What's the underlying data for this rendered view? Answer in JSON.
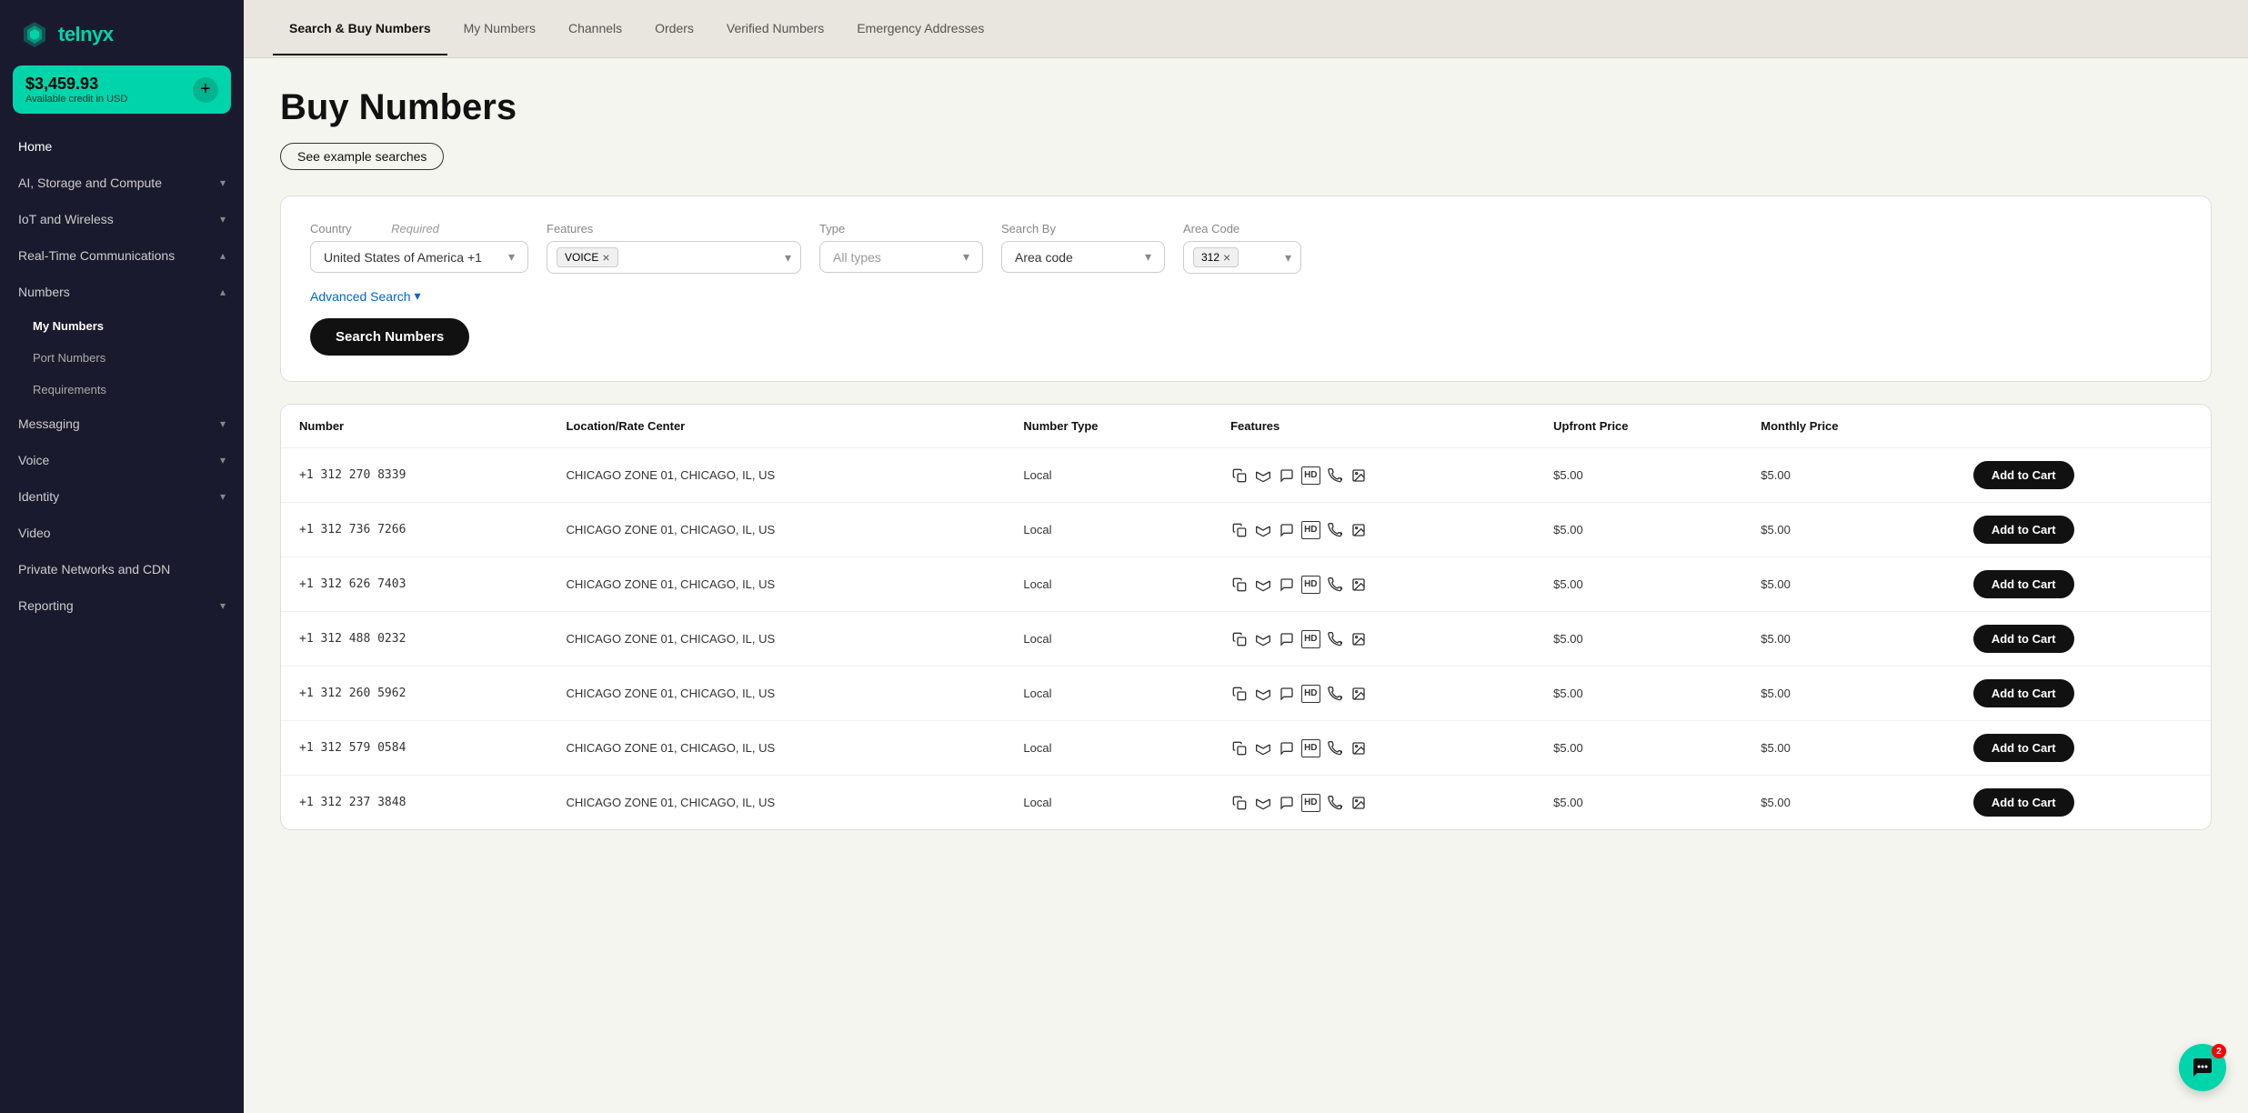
{
  "sidebar": {
    "logo": "telnyx",
    "credit": {
      "amount": "$3,459.93",
      "label": "Available credit in USD"
    },
    "nav_items": [
      {
        "id": "home",
        "label": "Home",
        "hasChildren": false
      },
      {
        "id": "ai-storage",
        "label": "AI, Storage and Compute",
        "hasChildren": true
      },
      {
        "id": "iot-wireless",
        "label": "IoT and Wireless",
        "hasChildren": true
      },
      {
        "id": "real-time",
        "label": "Real-Time Communications",
        "hasChildren": true,
        "expanded": true
      },
      {
        "id": "numbers",
        "label": "Numbers",
        "hasChildren": true,
        "expanded": true
      },
      {
        "id": "messaging",
        "label": "Messaging",
        "hasChildren": true
      },
      {
        "id": "voice",
        "label": "Voice",
        "hasChildren": true
      },
      {
        "id": "identity",
        "label": "Identity",
        "hasChildren": true
      },
      {
        "id": "video",
        "label": "Video",
        "hasChildren": false
      },
      {
        "id": "private-networks",
        "label": "Private Networks and CDN",
        "hasChildren": false
      },
      {
        "id": "reporting",
        "label": "Reporting",
        "hasChildren": true
      }
    ],
    "sub_items": [
      {
        "label": "My Numbers",
        "active": true
      },
      {
        "label": "Port Numbers",
        "active": false
      },
      {
        "label": "Requirements",
        "active": false
      }
    ]
  },
  "top_nav": {
    "tabs": [
      {
        "id": "search-buy",
        "label": "Search & Buy Numbers",
        "active": true
      },
      {
        "id": "my-numbers",
        "label": "My Numbers",
        "active": false
      },
      {
        "id": "channels",
        "label": "Channels",
        "active": false
      },
      {
        "id": "orders",
        "label": "Orders",
        "active": false
      },
      {
        "id": "verified",
        "label": "Verified Numbers",
        "active": false
      },
      {
        "id": "emergency",
        "label": "Emergency Addresses",
        "active": false
      }
    ]
  },
  "page": {
    "title": "Buy Numbers",
    "example_btn": "See example searches"
  },
  "search": {
    "country_label": "Country",
    "country_required": "Required",
    "country_value": "United States of America +1",
    "features_label": "Features",
    "features_tag": "VOICE",
    "type_label": "Type",
    "type_placeholder": "All types",
    "search_by_label": "Search By",
    "search_by_value": "Area code",
    "area_code_label": "Area Code",
    "area_code_tag": "312",
    "advanced_link": "Advanced Search",
    "search_btn": "Search Numbers"
  },
  "table": {
    "headers": [
      "Number",
      "Location/Rate Center",
      "Number Type",
      "Features",
      "Upfront Price",
      "Monthly Price",
      ""
    ],
    "rows": [
      {
        "number": "+1 312 270 8339",
        "location": "CHICAGO ZONE 01, CHICAGO, IL, US",
        "type": "Local",
        "upfront": "$5.00",
        "monthly": "$5.00"
      },
      {
        "number": "+1 312 736 7266",
        "location": "CHICAGO ZONE 01, CHICAGO, IL, US",
        "type": "Local",
        "upfront": "$5.00",
        "monthly": "$5.00"
      },
      {
        "number": "+1 312 626 7403",
        "location": "CHICAGO ZONE 01, CHICAGO, IL, US",
        "type": "Local",
        "upfront": "$5.00",
        "monthly": "$5.00"
      },
      {
        "number": "+1 312 488 0232",
        "location": "CHICAGO ZONE 01, CHICAGO, IL, US",
        "type": "Local",
        "upfront": "$5.00",
        "monthly": "$5.00"
      },
      {
        "number": "+1 312 260 5962",
        "location": "CHICAGO ZONE 01, CHICAGO, IL, US",
        "type": "Local",
        "upfront": "$5.00",
        "monthly": "$5.00"
      },
      {
        "number": "+1 312 579 0584",
        "location": "CHICAGO ZONE 01, CHICAGO, IL, US",
        "type": "Local",
        "upfront": "$5.00",
        "monthly": "$5.00"
      },
      {
        "number": "+1 312 237 3848",
        "location": "CHICAGO ZONE 01, CHICAGO, IL, US",
        "type": "Local",
        "upfront": "$5.00",
        "monthly": "$5.00"
      }
    ],
    "add_to_cart_label": "Add to Cart"
  },
  "chat": {
    "badge": "2"
  }
}
